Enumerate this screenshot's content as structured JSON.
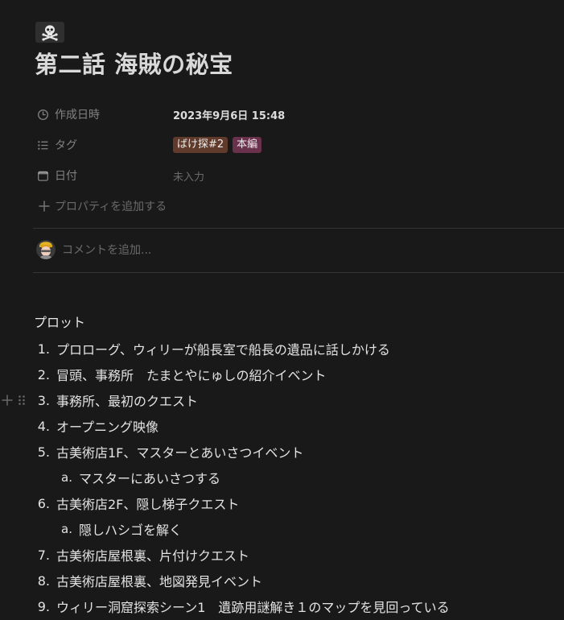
{
  "page": {
    "icon": "skull-crossbones-icon",
    "title": "第二話 海賊の秘宝"
  },
  "properties": [
    {
      "icon": "clock-icon",
      "name": "作成日時",
      "value": "2023年9月6日 15:48"
    },
    {
      "icon": "list-icon",
      "name": "タグ",
      "tags": [
        {
          "label": "ばけ探#2",
          "color": "#603b2c"
        },
        {
          "label": "本編",
          "color": "#69314c"
        }
      ]
    },
    {
      "icon": "calendar-icon",
      "name": "日付",
      "value": "未入力"
    }
  ],
  "add_property": {
    "icon": "plus-icon",
    "label": "プロパティを追加する"
  },
  "comment": {
    "avatar": "user-avatar",
    "placeholder": "コメントを追加..."
  },
  "content": {
    "heading": "プロット",
    "items": [
      {
        "num": "1.",
        "text": "プロローグ、ウィリーが船長室で船長の遺品に話しかける"
      },
      {
        "num": "2.",
        "text": "冒頭、事務所　たまとやにゅしの紹介イベント"
      },
      {
        "num": "3.",
        "text": "事務所、最初のクエスト"
      },
      {
        "num": "4.",
        "text": "オープニング映像"
      },
      {
        "num": "5.",
        "text": "古美術店1F、マスターとあいさつイベント"
      },
      {
        "num": "a.",
        "text": "マスターにあいさつする"
      },
      {
        "num": "6.",
        "text": "古美術店2F、隠し梯子クエスト"
      },
      {
        "num": "a.",
        "text": "隠しハシゴを解く"
      },
      {
        "num": "7.",
        "text": "古美術店屋根裏、片付けクエスト"
      },
      {
        "num": "8.",
        "text": "古美術店屋根裏、地図発見イベント"
      },
      {
        "num": "9.",
        "text": "ウィリー洞窟探索シーン1　遺跡用謎解き１のマップを見回っている"
      }
    ]
  },
  "block_tools": {
    "add_icon": "plus-icon",
    "drag_icon": "drag-handle-icon"
  }
}
